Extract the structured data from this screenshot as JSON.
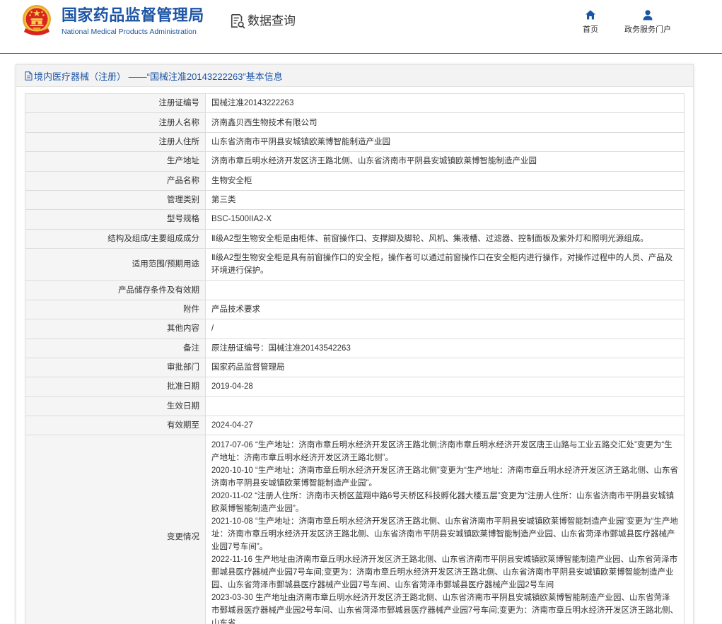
{
  "theme": {
    "brand_blue": "#1d55a5",
    "border": "#dcdcdc",
    "label_bg": "#f5f5f5"
  },
  "header": {
    "emblem_icon": "national-emblem-icon",
    "site_name_cn": "国家药品监督管理局",
    "site_name_en": "National Medical Products Administration",
    "query": {
      "icon": "document-search-icon",
      "label": "数据查询"
    },
    "nav": [
      {
        "icon": "home-icon",
        "label": "首页"
      },
      {
        "icon": "user-icon",
        "label": "政务服务门户"
      }
    ]
  },
  "panel": {
    "title_icon": "document-icon",
    "title": "境内医疗器械（注册） ——“国械注准20143222263”基本信息"
  },
  "rows": [
    {
      "label": "注册证编号",
      "value": "国械注准20143222263"
    },
    {
      "label": "注册人名称",
      "value": "济南鑫贝西生物技术有限公司"
    },
    {
      "label": "注册人住所",
      "value": "山东省济南市平阴县安城镇欧莱博智能制造产业园"
    },
    {
      "label": "生产地址",
      "value": "济南市章丘明水经济开发区济王路北侧、山东省济南市平阴县安城镇欧莱博智能制造产业园"
    },
    {
      "label": "产品名称",
      "value": "生物安全柜"
    },
    {
      "label": "管理类别",
      "value": "第三类"
    },
    {
      "label": "型号规格",
      "value": "BSC-1500IIA2-X"
    },
    {
      "label": "结构及组成/主要组成成分",
      "value": "Ⅱ级A2型生物安全柜是由柜体、前窗操作口、支撑脚及脚轮、风机、集液槽、过滤器、控制面板及紫外灯和照明光源组成。"
    },
    {
      "label": "适用范围/预期用途",
      "value": "Ⅱ级A2型生物安全柜是具有前窗操作口的安全柜，操作者可以通过前窗操作口在安全柜内进行操作，对操作过程中的人员、产品及环境进行保护。"
    },
    {
      "label": "产品储存条件及有效期"
    },
    {
      "label": "附件",
      "value": "产品技术要求"
    },
    {
      "label": "其他内容",
      "value": "/"
    },
    {
      "label": "备注",
      "value": "原注册证编号：国械注准20143542263"
    },
    {
      "label": "审批部门",
      "value": "国家药品监督管理局"
    },
    {
      "label": "批准日期",
      "value": "2019-04-28"
    },
    {
      "label": "生效日期"
    },
    {
      "label": "有效期至",
      "value": "2024-04-27"
    },
    {
      "label": "变更情况"
    }
  ],
  "changes": [
    {
      "date": "2017-07-06",
      "text": "“生产地址：济南市章丘明水经济开发区济王路北侧;济南市章丘明水经济开发区唐王山路与工业五路交汇处”变更为“生产地址：济南市章丘明水经济开发区济王路北侧”。"
    },
    {
      "date": "2020-10-10",
      "text": "“生产地址：济南市章丘明水经济开发区济王路北侧”变更为“生产地址：济南市章丘明水经济开发区济王路北侧、山东省济南市平阴县安城镇欧莱博智能制造产业园”。"
    },
    {
      "date": "2020-11-02",
      "text": "“注册人住所：济南市天桥区蓝翔中路6号天桥区科技孵化器大楼五层”变更为“注册人住所：山东省济南市平阴县安城镇欧莱博智能制造产业园”。"
    },
    {
      "date": "2021-10-08",
      "text": "“生产地址：济南市章丘明水经济开发区济王路北侧、山东省济南市平阴县安城镇欧莱博智能制造产业园”变更为“生产地址：济南市章丘明水经济开发区济王路北侧、山东省济南市平阴县安城镇欧莱博智能制造产业园、山东省菏泽市鄄城县医疗器械产业园7号车间”。"
    },
    {
      "date": "2022-11-16",
      "text": "生产地址由济南市章丘明水经济开发区济王路北侧、山东省济南市平阴县安城镇欧莱博智能制造产业园、山东省菏泽市鄄城县医疗器械产业园7号车间;变更为：济南市章丘明水经济开发区济王路北侧、山东省济南市平阴县安城镇欧莱博智能制造产业园、山东省菏泽市鄄城县医疗器械产业园7号车间、山东省菏泽市鄄城县医疗器械产业园2号车间"
    },
    {
      "date": "2023-03-30",
      "text": "生产地址由济南市章丘明水经济开发区济王路北侧、山东省济南市平阴县安城镇欧莱博智能制造产业园、山东省菏泽市鄄城县医疗器械产业园2号车间、山东省菏泽市鄄城县医疗器械产业园7号车间;变更为：济南市章丘明水经济开发区济王路北侧、山东省"
    }
  ]
}
